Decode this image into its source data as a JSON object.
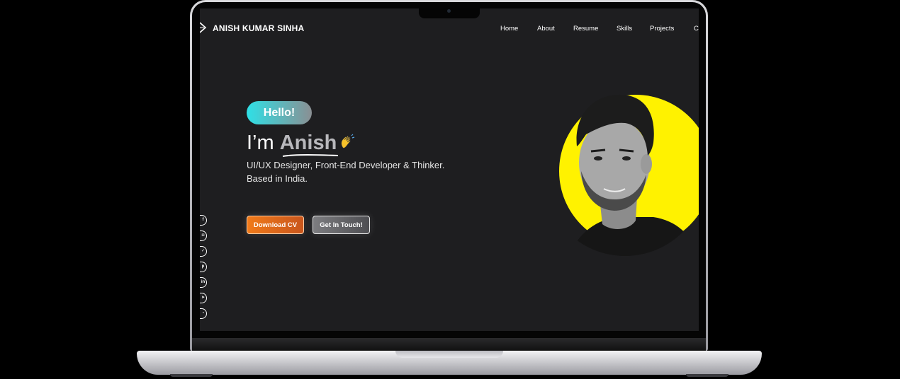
{
  "site": {
    "name": "ANISH KUMAR SINHA"
  },
  "nav": {
    "items": [
      {
        "label": "Home"
      },
      {
        "label": "About"
      },
      {
        "label": "Resume"
      },
      {
        "label": "Skills"
      },
      {
        "label": "Projects"
      },
      {
        "label": "Co"
      }
    ]
  },
  "hero": {
    "badge": "Hello!",
    "greeting": "I’m",
    "name": "Anish",
    "tagline_line1": "UI/UX Designer, Front-End Developer & Thinker.",
    "tagline_line2": "Based in India.",
    "download_label": "Download CV",
    "contact_label": "Get In Touch!"
  },
  "social": {
    "icons": [
      {
        "name": "facebook-icon",
        "glyph": "f"
      },
      {
        "name": "instagram-icon",
        "glyph": "◘"
      },
      {
        "name": "twitter-icon",
        "glyph": "✓"
      },
      {
        "name": "pinterest-icon",
        "glyph": "p"
      },
      {
        "name": "linkedin-icon",
        "glyph": "in"
      },
      {
        "name": "telegram-icon",
        "glyph": "➤"
      },
      {
        "name": "whatsapp-icon",
        "glyph": "◔"
      }
    ]
  },
  "colors": {
    "background": "#1e1e20",
    "accent_yellow": "#fff200",
    "accent_cyan": "#2fe0e6",
    "accent_orange": "#f07a1a"
  }
}
